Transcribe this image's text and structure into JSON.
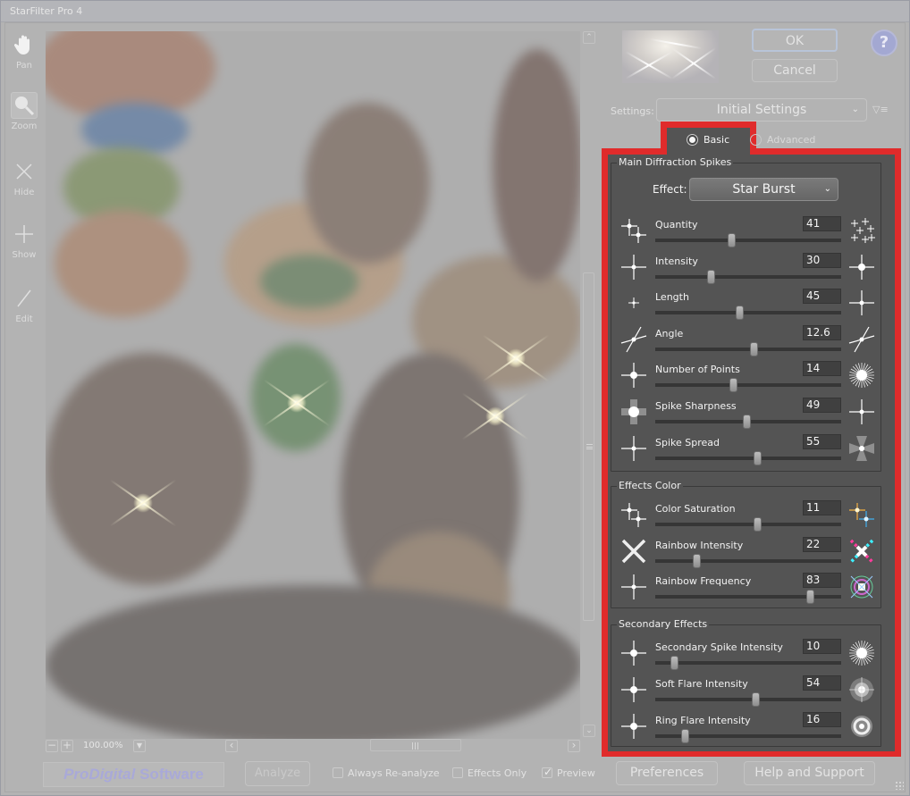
{
  "window": {
    "title": "StarFilter Pro 4"
  },
  "toolbar": {
    "tools": [
      {
        "name": "pan",
        "label": "Pan",
        "icon": "hand-icon",
        "active": false
      },
      {
        "name": "zoom",
        "label": "Zoom",
        "icon": "magnifier-icon",
        "active": true
      },
      {
        "name": "hide",
        "label": "Hide",
        "icon": "x-icon",
        "active": false
      },
      {
        "name": "show",
        "label": "Show",
        "icon": "plus-icon",
        "active": false
      },
      {
        "name": "edit",
        "label": "Edit",
        "icon": "pencil-icon",
        "active": false
      }
    ]
  },
  "preview": {
    "zoom_level": "100.00%",
    "zoom_out_glyph": "−",
    "zoom_in_glyph": "+",
    "zoom_menu_glyph": "▼",
    "scroll_up_glyph": "⌃",
    "scroll_down_glyph": "⌄",
    "scroll_left_glyph": "‹",
    "scroll_right_glyph": "›"
  },
  "actions": {
    "ok": "OK",
    "cancel": "Cancel",
    "help_glyph": "?"
  },
  "settings": {
    "label": "Settings:",
    "selected": "Initial Settings",
    "chevron": "⌄",
    "menu_glyph": "▽≡"
  },
  "tabs": [
    {
      "label": "Basic",
      "selected": true
    },
    {
      "label": "Advanced",
      "selected": false
    }
  ],
  "main_spikes": {
    "title": "Main Diffraction Spikes",
    "effect_label": "Effect:",
    "effect_value": "Star Burst",
    "effect_chevron": "⌄",
    "sliders": [
      {
        "label": "Quantity",
        "value": "41",
        "position": 0.41
      },
      {
        "label": "Intensity",
        "value": "30",
        "position": 0.3
      },
      {
        "label": "Length",
        "value": "45",
        "position": 0.45
      },
      {
        "label": "Angle",
        "value": "12.6",
        "position": 0.53
      },
      {
        "label": "Number of Points",
        "value": "14",
        "position": 0.42
      },
      {
        "label": "Spike Sharpness",
        "value": "49",
        "position": 0.49
      },
      {
        "label": "Spike Spread",
        "value": "55",
        "position": 0.55
      }
    ]
  },
  "effects_color": {
    "title": "Effects Color",
    "sliders": [
      {
        "label": "Color Saturation",
        "value": "11",
        "position": 0.55
      },
      {
        "label": "Rainbow Intensity",
        "value": "22",
        "position": 0.22
      },
      {
        "label": "Rainbow Frequency",
        "value": "83",
        "position": 0.83
      }
    ]
  },
  "secondary": {
    "title": "Secondary Effects",
    "sliders": [
      {
        "label": "Secondary Spike Intensity",
        "value": "10",
        "position": 0.1
      },
      {
        "label": "Soft Flare Intensity",
        "value": "54",
        "position": 0.54
      },
      {
        "label": "Ring Flare Intensity",
        "value": "16",
        "position": 0.16
      }
    ]
  },
  "bottom": {
    "logo_prefix": "ProDigital",
    "logo_suffix": " Software",
    "analyze": "Analyze",
    "always_reanalyze": {
      "label": "Always Re-analyze",
      "checked": false
    },
    "effects_only": {
      "label": "Effects Only",
      "checked": false
    },
    "preview": {
      "label": "Preview",
      "checked": true
    },
    "preferences": "Preferences",
    "help_support": "Help and Support"
  },
  "colors": {
    "highlight": "#e02b2b",
    "panel": "#545454",
    "dimmed_bg": "#b3b3b3"
  }
}
